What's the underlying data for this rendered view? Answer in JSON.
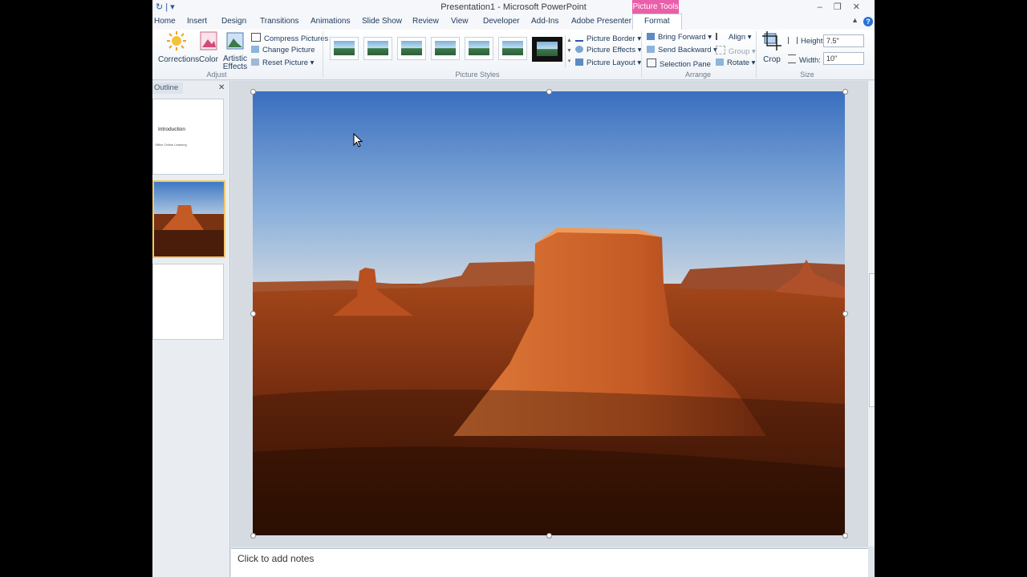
{
  "window": {
    "title": "Presentation1 - Microsoft PowerPoint",
    "contextual_tab_label": "Picture Tools"
  },
  "tabs": [
    {
      "label": "Home"
    },
    {
      "label": "Insert"
    },
    {
      "label": "Design"
    },
    {
      "label": "Transitions"
    },
    {
      "label": "Animations"
    },
    {
      "label": "Slide Show"
    },
    {
      "label": "Review"
    },
    {
      "label": "View"
    },
    {
      "label": "Developer"
    },
    {
      "label": "Add-Ins"
    },
    {
      "label": "Adobe Presenter"
    },
    {
      "label": "Format"
    }
  ],
  "ribbon": {
    "adjust": {
      "label": "Adjust",
      "corrections": "Corrections",
      "color": "Color",
      "artistic_line1": "Artistic",
      "artistic_line2": "Effects",
      "compress": "Compress Pictures",
      "change": "Change Picture",
      "reset": "Reset Picture"
    },
    "picture_styles": {
      "label": "Picture Styles",
      "border": "Picture Border",
      "effects": "Picture Effects",
      "layout": "Picture Layout"
    },
    "arrange": {
      "label": "Arrange",
      "bring_forward": "Bring Forward",
      "send_backward": "Send Backward",
      "selection_pane": "Selection Pane",
      "align": "Align",
      "group": "Group",
      "rotate": "Rotate"
    },
    "size": {
      "label": "Size",
      "crop": "Crop",
      "height_label": "Height:",
      "height_value": "7.5\"",
      "width_label": "Width:",
      "width_value": "10\""
    }
  },
  "left_pane": {
    "tab_label": "Outline",
    "slide1_title": "Introduction",
    "slide1_subtitle": "Office Online Learning"
  },
  "notes": {
    "placeholder": "Click to add notes"
  },
  "colors": {
    "contextual_tab": "#e95fa9",
    "selected_thumb_border": "#f3c86a"
  }
}
